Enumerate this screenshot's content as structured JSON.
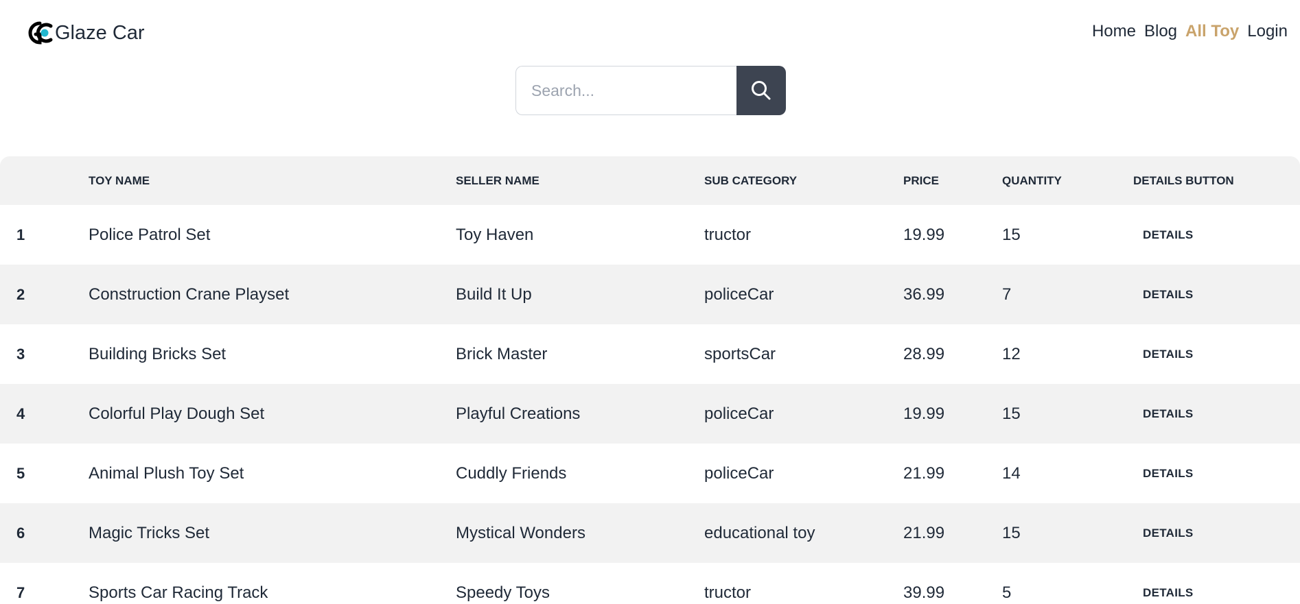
{
  "brand": {
    "name": "Glaze Car",
    "logo_icon": "gc-logo-icon",
    "logo_text": "GC",
    "logo_colors": {
      "dark": "#000000",
      "accent": "#22b8cf"
    }
  },
  "nav": {
    "items": [
      {
        "label": "Home",
        "active": false
      },
      {
        "label": "Blog",
        "active": false
      },
      {
        "label": "All Toy",
        "active": true
      },
      {
        "label": "Login",
        "active": false
      }
    ],
    "active_color": "#c9a36b"
  },
  "search": {
    "placeholder": "Search...",
    "value": "",
    "button_icon": "search-icon",
    "button_color": "#3d4451"
  },
  "table": {
    "headers": [
      "",
      "Toy Name",
      "Seller Name",
      "Sub Category",
      "Price",
      "Quantity",
      "Details Button"
    ],
    "rows": [
      {
        "index": "1",
        "toy_name": "Police Patrol Set",
        "seller_name": "Toy Haven",
        "sub_category": "tructor",
        "price": "19.99",
        "quantity": "15",
        "details": "DETAILS"
      },
      {
        "index": "2",
        "toy_name": "Construction Crane Playset",
        "seller_name": "Build It Up",
        "sub_category": "policeCar",
        "price": "36.99",
        "quantity": "7",
        "details": "DETAILS"
      },
      {
        "index": "3",
        "toy_name": "Building Bricks Set",
        "seller_name": "Brick Master",
        "sub_category": "sportsCar",
        "price": "28.99",
        "quantity": "12",
        "details": "DETAILS"
      },
      {
        "index": "4",
        "toy_name": "Colorful Play Dough Set",
        "seller_name": "Playful Creations",
        "sub_category": "policeCar",
        "price": "19.99",
        "quantity": "15",
        "details": "DETAILS"
      },
      {
        "index": "5",
        "toy_name": "Animal Plush Toy Set",
        "seller_name": "Cuddly Friends",
        "sub_category": "policeCar",
        "price": "21.99",
        "quantity": "14",
        "details": "DETAILS"
      },
      {
        "index": "6",
        "toy_name": "Magic Tricks Set",
        "seller_name": "Mystical Wonders",
        "sub_category": "educational toy",
        "price": "21.99",
        "quantity": "15",
        "details": "DETAILS"
      },
      {
        "index": "7",
        "toy_name": "Sports Car Racing Track",
        "seller_name": "Speedy Toys",
        "sub_category": "tructor",
        "price": "39.99",
        "quantity": "5",
        "details": "DETAILS"
      }
    ]
  }
}
